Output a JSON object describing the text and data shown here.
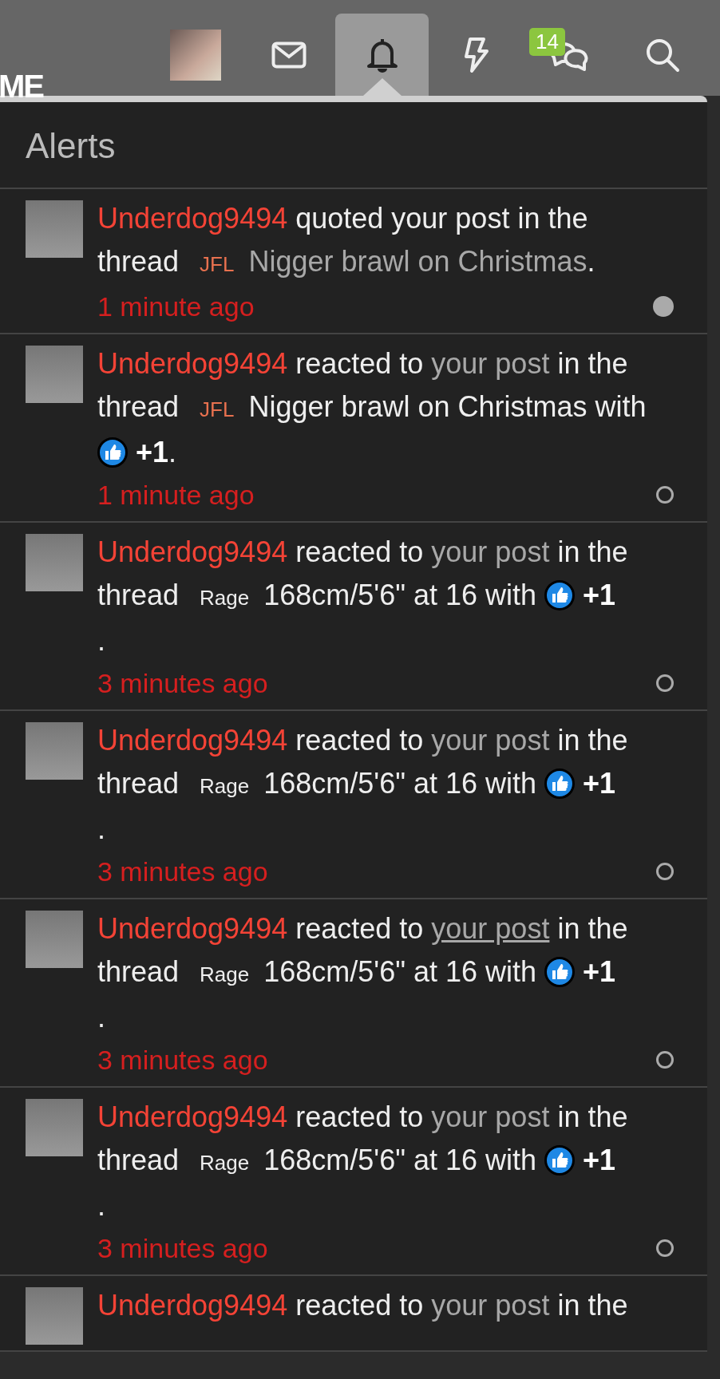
{
  "header": {
    "logo_text": "ME",
    "tabs": [
      {
        "kind": "avatar",
        "selected": false
      },
      {
        "kind": "mail",
        "selected": false
      },
      {
        "kind": "bell",
        "selected": true
      },
      {
        "kind": "bolt",
        "selected": false
      },
      {
        "kind": "chat",
        "selected": false,
        "badge": "14"
      },
      {
        "kind": "search",
        "selected": false
      }
    ]
  },
  "panel": {
    "title": "Alerts",
    "alerts": [
      {
        "read": false,
        "time": "1 minute ago",
        "parts": [
          {
            "kind": "user",
            "text": "Underdog9494"
          },
          {
            "kind": "text",
            "text": " quoted your post in the thread "
          },
          {
            "kind": "prefix",
            "text": "JFL",
            "color": "#e8714f"
          },
          {
            "kind": "link",
            "text": "Nigger brawl on Christmas",
            "underlined": false
          },
          {
            "kind": "text",
            "text": "."
          }
        ]
      },
      {
        "read": true,
        "time": "1 minute ago",
        "parts": [
          {
            "kind": "user",
            "text": "Underdog9494"
          },
          {
            "kind": "text",
            "text": " reacted to "
          },
          {
            "kind": "link",
            "text": "your post",
            "underlined": false
          },
          {
            "kind": "text",
            "text": " in the thread "
          },
          {
            "kind": "prefix",
            "text": "JFL",
            "color": "#e8714f"
          },
          {
            "kind": "text",
            "text": "Nigger brawl on Christmas with "
          },
          {
            "kind": "reaction",
            "text": "+1"
          },
          {
            "kind": "text",
            "text": "."
          }
        ]
      },
      {
        "read": true,
        "time": "3 minutes ago",
        "parts": [
          {
            "kind": "user",
            "text": "Underdog9494"
          },
          {
            "kind": "text",
            "text": " reacted to "
          },
          {
            "kind": "link",
            "text": "your post",
            "underlined": false
          },
          {
            "kind": "text",
            "text": " in the thread "
          },
          {
            "kind": "prefix",
            "text": "Rage",
            "color": "#eeeeee"
          },
          {
            "kind": "text",
            "text": "168cm/5'6\" at 16 with "
          },
          {
            "kind": "reaction",
            "text": "+1"
          },
          {
            "kind": "break"
          },
          {
            "kind": "text",
            "text": "."
          }
        ]
      },
      {
        "read": true,
        "time": "3 minutes ago",
        "parts": [
          {
            "kind": "user",
            "text": "Underdog9494"
          },
          {
            "kind": "text",
            "text": " reacted to "
          },
          {
            "kind": "link",
            "text": "your post",
            "underlined": false
          },
          {
            "kind": "text",
            "text": " in the thread "
          },
          {
            "kind": "prefix",
            "text": "Rage",
            "color": "#eeeeee"
          },
          {
            "kind": "text",
            "text": "168cm/5'6\" at 16 with "
          },
          {
            "kind": "reaction",
            "text": "+1"
          },
          {
            "kind": "break"
          },
          {
            "kind": "text",
            "text": "."
          }
        ]
      },
      {
        "read": true,
        "time": "3 minutes ago",
        "parts": [
          {
            "kind": "user",
            "text": "Underdog9494"
          },
          {
            "kind": "text",
            "text": " reacted to "
          },
          {
            "kind": "link",
            "text": "your post",
            "underlined": true
          },
          {
            "kind": "text",
            "text": " in the thread "
          },
          {
            "kind": "prefix",
            "text": "Rage",
            "color": "#eeeeee"
          },
          {
            "kind": "text",
            "text": "168cm/5'6\" at 16 with "
          },
          {
            "kind": "reaction",
            "text": "+1"
          },
          {
            "kind": "break"
          },
          {
            "kind": "text",
            "text": "."
          }
        ]
      },
      {
        "read": true,
        "time": "3 minutes ago",
        "parts": [
          {
            "kind": "user",
            "text": "Underdog9494"
          },
          {
            "kind": "text",
            "text": " reacted to "
          },
          {
            "kind": "link",
            "text": "your post",
            "underlined": false
          },
          {
            "kind": "text",
            "text": " in the thread "
          },
          {
            "kind": "prefix",
            "text": "Rage",
            "color": "#eeeeee"
          },
          {
            "kind": "text",
            "text": "168cm/5'6\" at 16 with "
          },
          {
            "kind": "reaction",
            "text": "+1"
          },
          {
            "kind": "break"
          },
          {
            "kind": "text",
            "text": "."
          }
        ]
      },
      {
        "parts": [
          {
            "kind": "user",
            "text": "Underdog9494"
          },
          {
            "kind": "text",
            "text": " reacted to "
          },
          {
            "kind": "link",
            "text": "your post",
            "underlined": false
          },
          {
            "kind": "text",
            "text": " in the"
          }
        ]
      }
    ]
  }
}
